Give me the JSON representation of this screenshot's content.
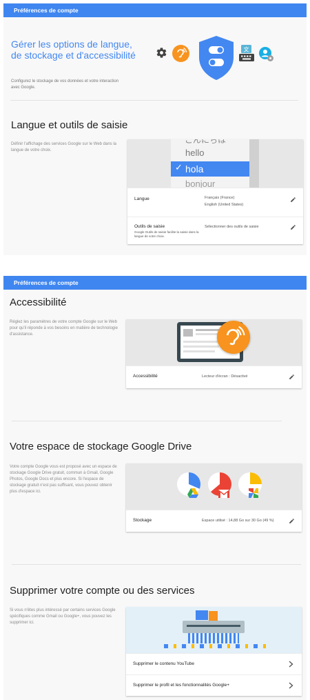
{
  "panel1": {
    "topbar_title": "Préférences de compte",
    "hero": {
      "title": "Gérer les options de langue, de stockage et d'accessibilité",
      "description": "Configurez le stockage de vos données et votre interaction avec Google."
    },
    "language_section": {
      "title": "Langue et outils de saisie",
      "description": "Définir l'affichage des services Google sur le Web dans la langue de votre choix.",
      "picker_words": [
        "こんにちは",
        "hello",
        "hola",
        "bonjour"
      ],
      "selected_word": "hola",
      "rows": [
        {
          "label": "Langue",
          "values": [
            "Français (France)",
            "English (United States)"
          ]
        },
        {
          "label": "Outils de saisie",
          "sublabel": "Google Outils de saisie facilite la saisie dans la langue de votre choix.",
          "values": [
            "Sélectionner des outils de saisie"
          ]
        }
      ]
    }
  },
  "panel2": {
    "topbar_title": "Préférences de compte",
    "accessibility": {
      "title": "Accessibilité",
      "description": "Réglez les paramètres de votre compte Google sur le Web pour qu'il réponde à vos besoins en matière de technologie d'assistance.",
      "row": {
        "label": "Accessibilité",
        "value": "Lecteur d'écran : Désactivé"
      }
    },
    "storage": {
      "title": "Votre espace de stockage Google Drive",
      "description": "Votre compte Google vous est proposé avec un espace de stockage Google Drive gratuit, commun à Gmail, Google Photos, Google Docs et plus encore. Si l'espace de stockage gratuit n'est pas suffisant, vous pouvez obtenir plus d'espace ici.",
      "row": {
        "label": "Stockage",
        "value": "Espace utilisé : 14,88 Go sur 30 Go (49 %)"
      }
    },
    "delete": {
      "title": "Supprimer votre compte ou des services",
      "description": "Si vous n'êtes plus intéressé par certains services Google spécifiques comme Gmail ou Google+, vous pouvez les supprimer ici.",
      "rows": [
        {
          "label": "Supprimer le contenu YouTube"
        },
        {
          "label": "Supprimer le profil et les fonctionnalités Google+"
        }
      ]
    }
  },
  "colors": {
    "brand_blue": "#3f86f0",
    "accent_orange": "#f7931e",
    "title_blue": "#4387f1",
    "drive_yellow": "#fbbc05",
    "drive_red": "#ea4335",
    "drive_green": "#34a853"
  },
  "icons": [
    "gear-icon",
    "hearing-icon",
    "shield-icon",
    "keyboard-translate-icon",
    "account-settings-icon",
    "edit-icon",
    "chevron-right-icon",
    "check-icon",
    "google-drive-icon",
    "gmail-icon",
    "google-photos-icon"
  ]
}
